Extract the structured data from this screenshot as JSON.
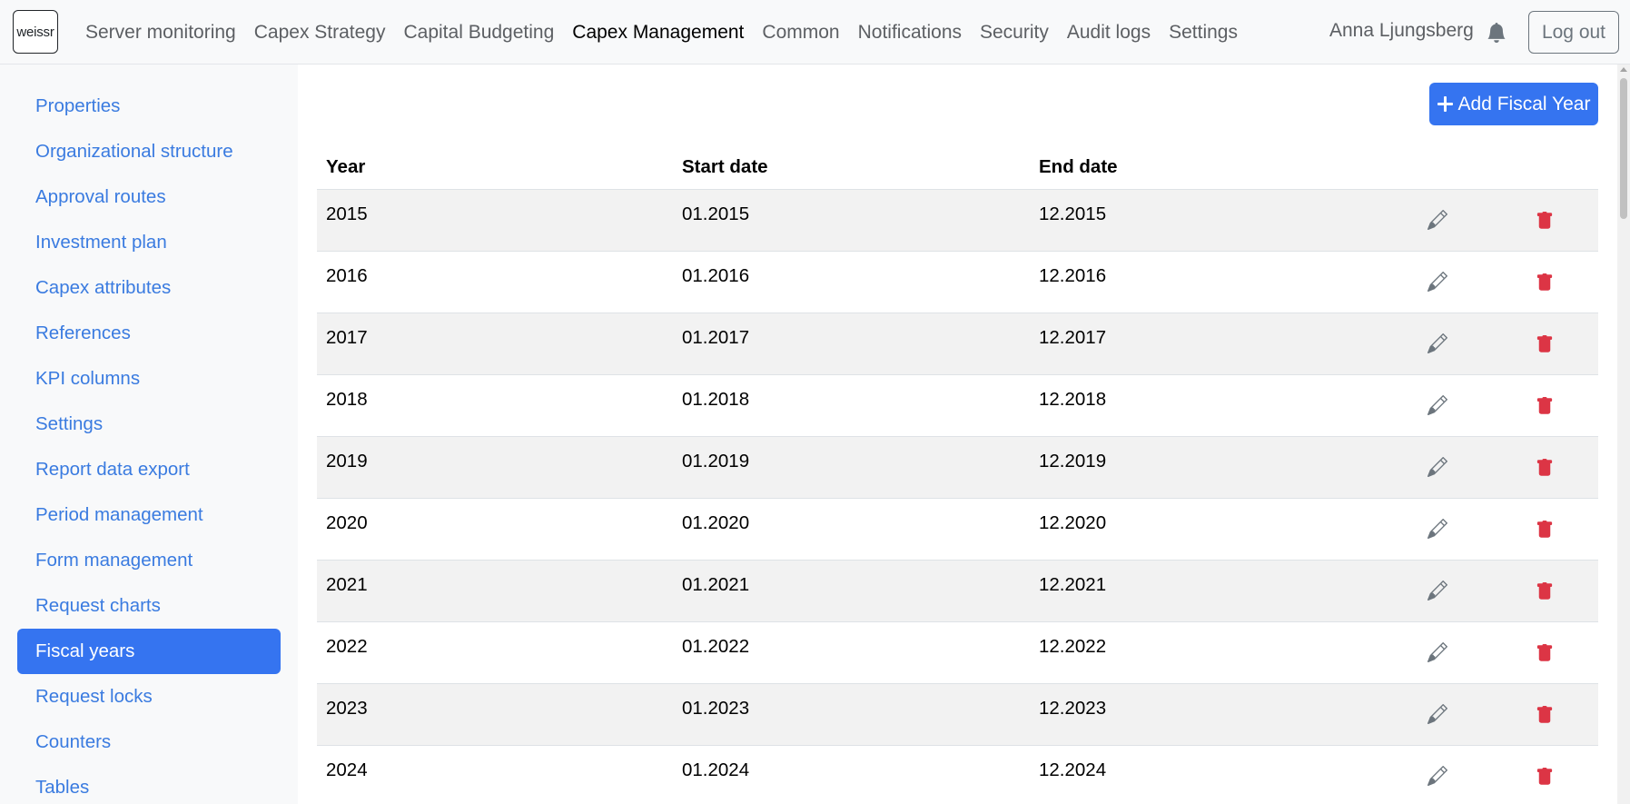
{
  "brand": {
    "logo_text": "weissr"
  },
  "nav": {
    "items": [
      {
        "label": "Server monitoring",
        "active": false
      },
      {
        "label": "Capex Strategy",
        "active": false
      },
      {
        "label": "Capital Budgeting",
        "active": false
      },
      {
        "label": "Capex Management",
        "active": true
      },
      {
        "label": "Common",
        "active": false
      },
      {
        "label": "Notifications",
        "active": false
      },
      {
        "label": "Security",
        "active": false
      },
      {
        "label": "Audit logs",
        "active": false
      },
      {
        "label": "Settings",
        "active": false
      }
    ],
    "user_name": "Anna Ljungsberg",
    "notification_icon": "bell-icon",
    "logout_label": "Log out"
  },
  "sidebar": {
    "items": [
      {
        "label": "Properties",
        "active": false
      },
      {
        "label": "Organizational structure",
        "active": false
      },
      {
        "label": "Approval routes",
        "active": false
      },
      {
        "label": "Investment plan",
        "active": false
      },
      {
        "label": "Capex attributes",
        "active": false
      },
      {
        "label": "References",
        "active": false
      },
      {
        "label": "KPI columns",
        "active": false
      },
      {
        "label": "Settings",
        "active": false
      },
      {
        "label": "Report data export",
        "active": false
      },
      {
        "label": "Period management",
        "active": false
      },
      {
        "label": "Form management",
        "active": false
      },
      {
        "label": "Request charts",
        "active": false
      },
      {
        "label": "Fiscal years",
        "active": true
      },
      {
        "label": "Request locks",
        "active": false
      },
      {
        "label": "Counters",
        "active": false
      },
      {
        "label": "Tables",
        "active": false
      }
    ]
  },
  "main": {
    "add_button_label": "Add Fiscal Year",
    "add_button_icon": "plus-icon",
    "table": {
      "columns": [
        "Year",
        "Start date",
        "End date"
      ],
      "rows": [
        {
          "year": "2015",
          "start": "01.2015",
          "end": "12.2015"
        },
        {
          "year": "2016",
          "start": "01.2016",
          "end": "12.2016"
        },
        {
          "year": "2017",
          "start": "01.2017",
          "end": "12.2017"
        },
        {
          "year": "2018",
          "start": "01.2018",
          "end": "12.2018"
        },
        {
          "year": "2019",
          "start": "01.2019",
          "end": "12.2019"
        },
        {
          "year": "2020",
          "start": "01.2020",
          "end": "12.2020"
        },
        {
          "year": "2021",
          "start": "01.2021",
          "end": "12.2021"
        },
        {
          "year": "2022",
          "start": "01.2022",
          "end": "12.2022"
        },
        {
          "year": "2023",
          "start": "01.2023",
          "end": "12.2023"
        },
        {
          "year": "2024",
          "start": "01.2024",
          "end": "12.2024"
        }
      ],
      "row_actions": {
        "edit_icon": "pencil-icon",
        "delete_icon": "trash-icon"
      }
    }
  },
  "colors": {
    "primary": "#3574f0",
    "sidebar_link": "#3a7be0",
    "danger": "#dc3545",
    "edit_icon": "#6c757d",
    "navbar_bg": "#f8f9fa",
    "stripe": "#f2f2f2"
  }
}
